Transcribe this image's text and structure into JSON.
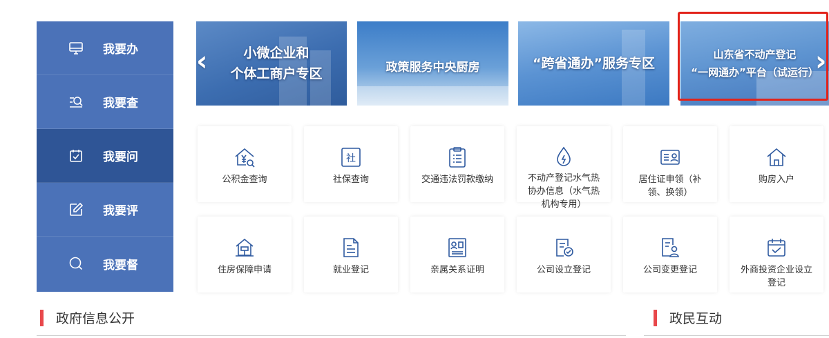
{
  "side_nav": {
    "items": [
      {
        "label": "我要办",
        "icon": "monitor-icon",
        "active": false
      },
      {
        "label": "我要查",
        "icon": "search-list-icon",
        "active": false
      },
      {
        "label": "我要问",
        "icon": "calendar-check-icon",
        "active": true
      },
      {
        "label": "我要评",
        "icon": "edit-icon",
        "active": false
      },
      {
        "label": "我要督",
        "icon": "search-icon",
        "active": false
      }
    ]
  },
  "banners": [
    {
      "line1": "小微企业和",
      "line2": "个体工商户专区"
    },
    {
      "line1": "政策服务中央厨房",
      "line2": ""
    },
    {
      "line1": "“跨省通办”服务专区",
      "line2": ""
    },
    {
      "line1": "山东省不动产登记",
      "line2": "“一网通办”平台（试运行）"
    }
  ],
  "carousel": {
    "prev_icon": "chevron-left-icon",
    "next_icon": "chevron-right-icon",
    "prev_glyph": "‹",
    "next_glyph": "›"
  },
  "highlight_color": "#e2231a",
  "services": [
    {
      "label": "公积金查询",
      "icon": "house-yuan-icon"
    },
    {
      "label": "社保查询",
      "icon": "social-security-icon"
    },
    {
      "label": "交通违法罚款缴纳",
      "icon": "clipboard-list-icon"
    },
    {
      "label": "不动产登记水气热协办信息（水气热机构专用）",
      "icon": "water-drop-icon"
    },
    {
      "label": "居住证申领（补领、换领）",
      "icon": "id-card-icon"
    },
    {
      "label": "购房入户",
      "icon": "home-icon"
    },
    {
      "label": "住房保障申请",
      "icon": "housing-icon"
    },
    {
      "label": "就业登记",
      "icon": "document-icon"
    },
    {
      "label": "亲属关系证明",
      "icon": "certificate-icon"
    },
    {
      "label": "公司设立登记",
      "icon": "document-check-icon"
    },
    {
      "label": "公司变更登记",
      "icon": "document-user-icon"
    },
    {
      "label": "外商投资企业设立登记",
      "icon": "calendar-check-icon"
    }
  ],
  "sections": {
    "gov_info": "政府信息公开",
    "interaction": "政民互动"
  },
  "colors": {
    "nav_bg": "#4b72b8",
    "nav_active": "#2f5596",
    "icon_blue": "#2f5aa0",
    "section_bar": "#e8484b"
  }
}
